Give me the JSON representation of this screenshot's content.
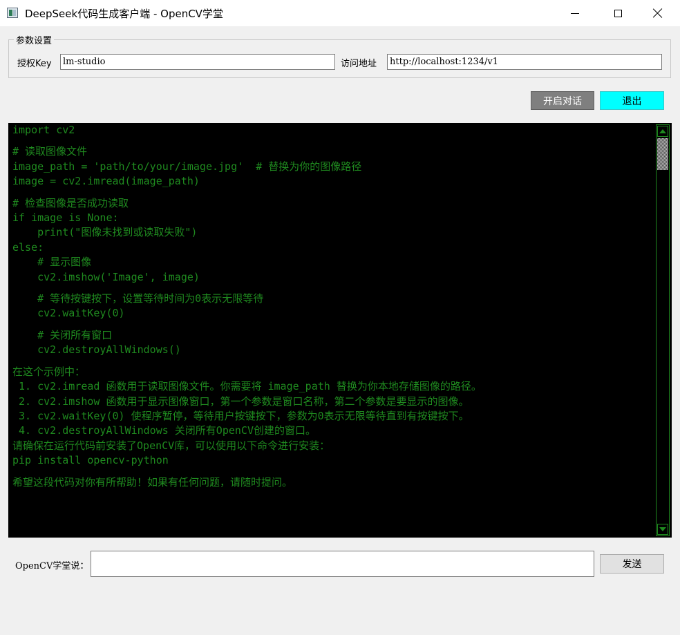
{
  "window": {
    "title": "DeepSeek代码生成客户端 - OpenCV学堂",
    "icon": "app-window-icon",
    "controls": [
      "minimize-icon",
      "maximize-icon",
      "close-icon"
    ]
  },
  "params": {
    "legend": "参数设置",
    "key_label": "授权Key",
    "key_value": "lm-studio",
    "url_label": "访问地址",
    "url_value": "http://localhost:1234/v1"
  },
  "toolbar": {
    "open_label": "开启对话",
    "exit_label": "退出"
  },
  "console": {
    "lines": [
      "import cv2",
      "",
      "# 读取图像文件",
      "image_path = 'path/to/your/image.jpg'  # 替换为你的图像路径",
      "image = cv2.imread(image_path)",
      "",
      "# 检查图像是否成功读取",
      "if image is None:",
      "    print(\"图像未找到或读取失败\")",
      "else:",
      "    # 显示图像",
      "    cv2.imshow('Image', image)",
      "",
      "    # 等待按键按下，设置等待时间为0表示无限等待",
      "    cv2.waitKey(0)",
      "",
      "    # 关闭所有窗口",
      "    cv2.destroyAllWindows()",
      "",
      "在这个示例中：",
      " 1. cv2.imread 函数用于读取图像文件。你需要将 image_path 替换为你本地存储图像的路径。",
      " 2. cv2.imshow 函数用于显示图像窗口，第一个参数是窗口名称，第二个参数是要显示的图像。",
      " 3. cv2.waitKey(0) 使程序暂停，等待用户按键按下，参数为0表示无限等待直到有按键按下。",
      " 4. cv2.destroyAllWindows 关闭所有OpenCV创建的窗口。",
      "请确保在运行代码前安装了OpenCV库，可以使用以下命令进行安装：",
      "pip install opencv-python",
      "",
      "希望这段代码对你有所帮助！如果有任何问题，请随时提问。"
    ],
    "text_color": "#1f8a1f",
    "background": "#000000"
  },
  "prompt": {
    "label": "OpenCV学堂说：",
    "value": "",
    "send_label": "发送"
  }
}
